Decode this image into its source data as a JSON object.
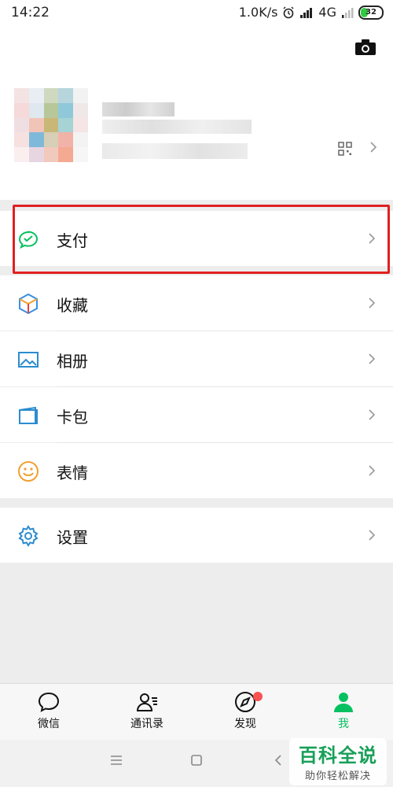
{
  "status_bar": {
    "time": "14:22",
    "net_speed": "1.0K/s",
    "network": "4G",
    "battery": "32"
  },
  "profile": {
    "camera_icon": "camera-icon",
    "qr_icon": "qr-code-icon"
  },
  "menu": {
    "pay": "支付",
    "favorites": "收藏",
    "album": "相册",
    "cards": "卡包",
    "stickers": "表情",
    "settings": "设置"
  },
  "tabs": {
    "chats": "微信",
    "contacts": "通讯录",
    "discover": "发现",
    "me": "我"
  },
  "watermark": {
    "title": "百科全说",
    "subtitle": "助你轻松解决"
  },
  "colors": {
    "accent": "#07c160",
    "highlight": "#e02020"
  }
}
